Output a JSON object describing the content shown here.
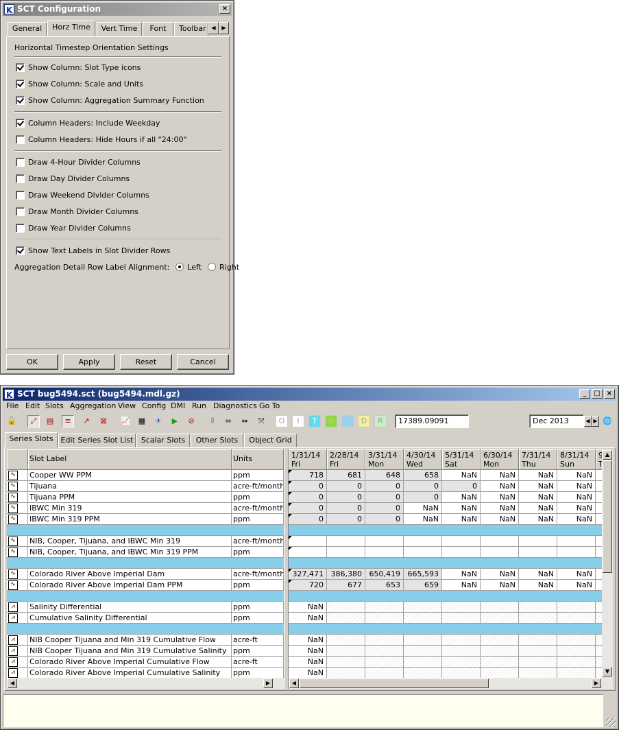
{
  "config_dialog": {
    "title": "SCT Configuration",
    "tabs": [
      "General",
      "Horz Time",
      "Vert Time",
      "Font",
      "Toolbar"
    ],
    "section_title": "Horizontal Timestep Orientation Settings",
    "options": [
      {
        "label": "Show Column: Slot Type icons",
        "checked": true
      },
      {
        "label": "Show Column: Scale and Units",
        "checked": true
      },
      {
        "label": "Show Column: Aggregation Summary Function",
        "checked": true
      },
      {
        "label": "Column Headers: Include Weekday",
        "checked": true
      },
      {
        "label": "Column Headers: Hide Hours if all \"24:00\"",
        "checked": false
      },
      {
        "label": "Draw 4-Hour Divider Columns",
        "checked": false
      },
      {
        "label": "Draw Day Divider Columns",
        "checked": false
      },
      {
        "label": "Draw Weekend Divider Columns",
        "checked": false
      },
      {
        "label": "Draw Month Divider Columns",
        "checked": false
      },
      {
        "label": "Draw Year Divider Columns",
        "checked": false
      },
      {
        "label": "Show Text Labels in Slot Divider Rows",
        "checked": true
      }
    ],
    "alignment_label": "Aggregation Detail Row Label Alignment:",
    "alignment_left": "Left",
    "alignment_right": "Right",
    "alignment_selected": "Left",
    "buttons": {
      "ok": "OK",
      "apply": "Apply",
      "reset": "Reset",
      "cancel": "Cancel"
    }
  },
  "sct_window": {
    "title": "SCT bug5494.sct (bug5494.mdl.gz)",
    "menus": [
      "File",
      "Edit",
      "Slots",
      "Aggregation",
      "View",
      "Config",
      "DMI",
      "Run",
      "Diagnostics",
      "Go To"
    ],
    "toolbar_letters": [
      "O",
      "I",
      "T",
      "B",
      "",
      "D",
      "R"
    ],
    "toolbar_letter_colors": [
      "#ffffff",
      "#ffffff",
      "#5fdcef",
      "#8ed84a",
      "#9ed0ea",
      "#f5ef9a",
      "#c8f0c8"
    ],
    "value_field": "17389.09091",
    "date_field": "Dec 2013",
    "tabs": [
      "Series Slots",
      "Edit Series Slot List",
      "Scalar Slots",
      "Other Slots",
      "Object Grid"
    ],
    "columns": {
      "slot_label": "Slot Label",
      "units": "Units"
    },
    "timesteps": [
      {
        "date": "1/31/14",
        "day": "Fri"
      },
      {
        "date": "2/28/14",
        "day": "Fri"
      },
      {
        "date": "3/31/14",
        "day": "Mon"
      },
      {
        "date": "4/30/14",
        "day": "Wed"
      },
      {
        "date": "5/31/14",
        "day": "Sat"
      },
      {
        "date": "6/30/14",
        "day": "Mon"
      },
      {
        "date": "7/31/14",
        "day": "Thu"
      },
      {
        "date": "8/31/14",
        "day": "Sun"
      },
      {
        "date": "9",
        "day": "T"
      }
    ],
    "rows": [
      {
        "label": "Cooper WW PPM",
        "units": "ppm",
        "values": [
          "718",
          "681",
          "648",
          "658",
          "NaN",
          "NaN",
          "NaN",
          "NaN"
        ],
        "gray": 4
      },
      {
        "label": "Tijuana",
        "units": "acre-ft/month",
        "values": [
          "0",
          "0",
          "0",
          "0",
          "0",
          "NaN",
          "NaN",
          "NaN"
        ],
        "gray": 5
      },
      {
        "label": "Tijuana PPM",
        "units": "ppm",
        "values": [
          "0",
          "0",
          "0",
          "0",
          "NaN",
          "NaN",
          "NaN",
          "NaN"
        ],
        "gray": 4
      },
      {
        "label": "IBWC Min 319",
        "units": "acre-ft/month",
        "values": [
          "0",
          "0",
          "0",
          "NaN",
          "NaN",
          "NaN",
          "NaN",
          "NaN"
        ],
        "gray": 3
      },
      {
        "label": "IBWC Min 319 PPM",
        "units": "ppm",
        "values": [
          "0",
          "0",
          "0",
          "NaN",
          "NaN",
          "NaN",
          "NaN",
          "NaN"
        ],
        "gray": 3
      },
      {
        "divider": true
      },
      {
        "label": "NIB, Cooper, Tijuana, and IBWC Min 319",
        "units": "acre-ft/month",
        "values": [
          "",
          "",
          "",
          "",
          "",
          "",
          "",
          ""
        ],
        "gray": 0,
        "flag": true
      },
      {
        "label": "NIB, Cooper, Tijuana, and IBWC Min 319 PPM",
        "units": "ppm",
        "values": [
          "",
          "",
          "",
          "",
          "",
          "",
          "",
          ""
        ],
        "gray": 0,
        "flag": true
      },
      {
        "divider": true
      },
      {
        "label": "Colorado River Above Imperial Dam",
        "units": "acre-ft/month",
        "values": [
          "327,471",
          "386,380",
          "650,419",
          "665,593",
          "NaN",
          "NaN",
          "NaN",
          "NaN"
        ],
        "gray": 4
      },
      {
        "label": "Colorado River Above Imperial Dam PPM",
        "units": "ppm",
        "values": [
          "720",
          "677",
          "653",
          "659",
          "NaN",
          "NaN",
          "NaN",
          "NaN"
        ],
        "gray": 4
      },
      {
        "divider": true
      },
      {
        "label": "Salinity Differential",
        "units": "ppm",
        "values": [
          "NaN",
          "",
          "",
          "",
          "",
          "",
          "",
          ""
        ],
        "gray": 0,
        "hatch": true
      },
      {
        "label": "Cumulative Salinity Differential",
        "units": "ppm",
        "values": [
          "NaN",
          "",
          "",
          "",
          "",
          "",
          "",
          ""
        ],
        "gray": 0,
        "hatch": true
      },
      {
        "divider": true
      },
      {
        "label": "NIB Cooper Tijuana and Min 319 Cumulative Flow",
        "units": "acre-ft",
        "values": [
          "NaN",
          "",
          "",
          "",
          "",
          "",
          "",
          ""
        ],
        "gray": 0,
        "hatch": true
      },
      {
        "label": "NIB Cooper Tijuana and Min 319 Cumulative Salinity",
        "units": "ppm",
        "values": [
          "NaN",
          "",
          "",
          "",
          "",
          "",
          "",
          ""
        ],
        "gray": 0,
        "hatch": true
      },
      {
        "label": "Colorado River Above Imperial Cumulative Flow",
        "units": "acre-ft",
        "values": [
          "NaN",
          "",
          "",
          "",
          "",
          "",
          "",
          ""
        ],
        "gray": 0,
        "hatch": true
      },
      {
        "label": "Colorado River Above Imperial Cumulative Salinity",
        "units": "ppm",
        "values": [
          "NaN",
          "",
          "",
          "",
          "",
          "",
          "",
          ""
        ],
        "gray": 0,
        "hatch": true
      },
      {
        "divider": true
      }
    ]
  }
}
